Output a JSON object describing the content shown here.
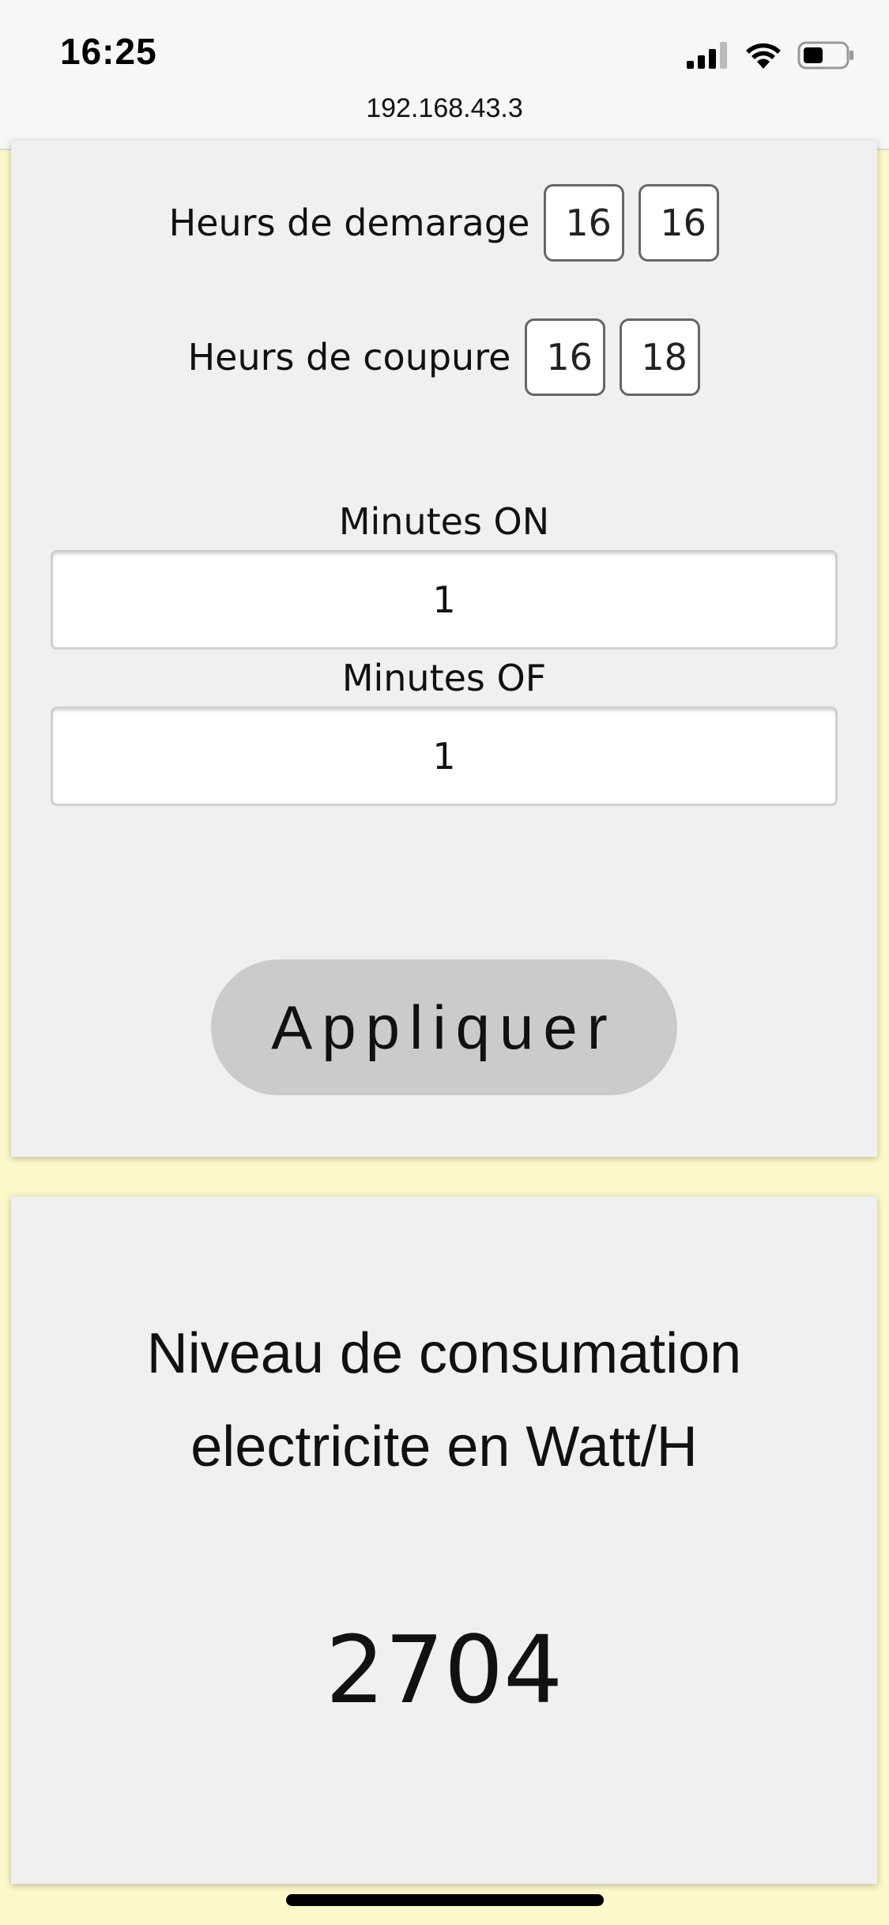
{
  "status_bar": {
    "time": "16:25",
    "url": "192.168.43.3",
    "icons": [
      "cellular-signal-icon",
      "wifi-icon",
      "battery-icon"
    ]
  },
  "schedule": {
    "start_label": "Heurs de demarage",
    "start_hour": "16",
    "start_minute": "16",
    "stop_label": "Heurs de coupure",
    "stop_hour": "16",
    "stop_minute": "18"
  },
  "cycle": {
    "minutes_on_label": "Minutes ON",
    "minutes_on_value": "1",
    "minutes_off_label": "Minutes OF",
    "minutes_off_value": "1"
  },
  "apply_label": "Appliquer",
  "consumption": {
    "title_line1": "Niveau de consumation",
    "title_line2": "electricite en Watt/H",
    "value": "2704"
  },
  "colors": {
    "page_background": "#fbf8c9",
    "panel_background": "#f0f0f0",
    "button_background": "#cbcbcb"
  }
}
